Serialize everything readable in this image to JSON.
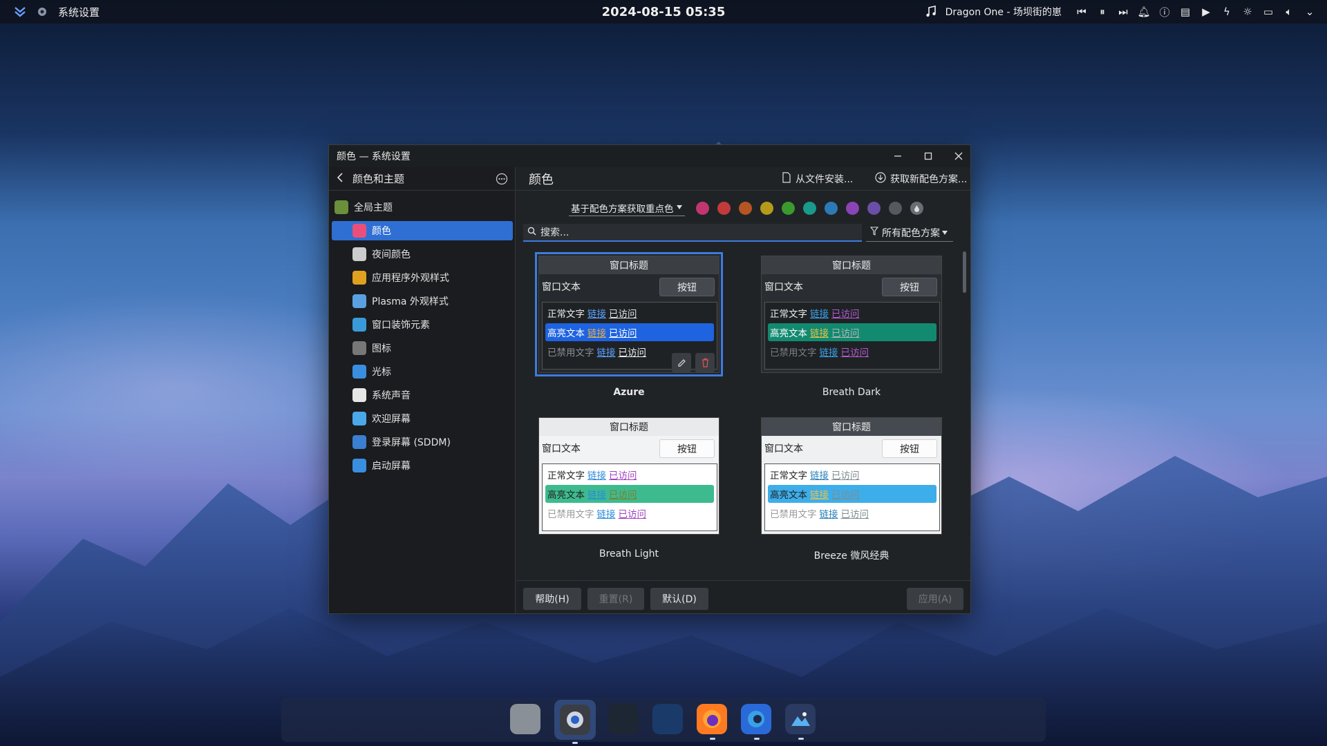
{
  "topbar": {
    "app_name": "系统设置",
    "datetime": "2024-08-15 05:35",
    "media_title": "Dragon One - 场坝街的崽"
  },
  "window": {
    "title": "颜色 — 系统设置",
    "sidebar_header": "颜色和主题",
    "page_title": "颜色",
    "install_from_file": "从文件安装...",
    "get_new": "获取新配色方案..."
  },
  "sidebar": {
    "items": [
      {
        "label": "全局主题",
        "icon": "global-theme-icon",
        "color": "#6b8f3a"
      },
      {
        "label": "颜色",
        "icon": "color-icon",
        "color": "#e8507a",
        "active": true
      },
      {
        "label": "夜间颜色",
        "icon": "bulb-icon",
        "color": "#cccccc"
      },
      {
        "label": "应用程序外观样式",
        "icon": "app-style-icon",
        "color": "#e0a020"
      },
      {
        "label": "Plasma 外观样式",
        "icon": "plasma-style-icon",
        "color": "#5aa0e0"
      },
      {
        "label": "窗口装饰元素",
        "icon": "window-deco-icon",
        "color": "#3a9ad9"
      },
      {
        "label": "图标",
        "icon": "icons-icon",
        "color": "#777777"
      },
      {
        "label": "光标",
        "icon": "cursor-icon",
        "color": "#3a8ee0"
      },
      {
        "label": "系统声音",
        "icon": "music-icon",
        "color": "#e6e6e6"
      },
      {
        "label": "欢迎屏幕",
        "icon": "splash-icon",
        "color": "#4aa8e8"
      },
      {
        "label": "登录屏幕 (SDDM)",
        "icon": "login-icon",
        "color": "#3a7fd0"
      },
      {
        "label": "启动屏幕",
        "icon": "boot-icon",
        "color": "#3a8ee0"
      }
    ]
  },
  "filters": {
    "accent_select": "基于配色方案获取重点色",
    "accent_colors": [
      "#c2366f",
      "#c23b3b",
      "#b55524",
      "#b59a1c",
      "#3a9a2e",
      "#1a9a8a",
      "#2c7ab5",
      "#8a44b5",
      "#6b4ea8",
      "#555a60",
      "#6a6e74"
    ],
    "search_placeholder": "搜索...",
    "scheme_filter": "所有配色方案"
  },
  "schemes": [
    {
      "name": "Azure",
      "title": "窗口标题",
      "window_text": "窗口文本",
      "button": "按钮",
      "normal": "正常文字",
      "link": "链接",
      "visited": "已访问",
      "highlight": "高亮文本",
      "disabled": "已禁用文字",
      "selected": true
    },
    {
      "name": "Breath Dark",
      "title": "窗口标题",
      "window_text": "窗口文本",
      "button": "按钮",
      "normal": "正常文字",
      "link": "链接",
      "visited": "已访问",
      "highlight": "高亮文本",
      "disabled": "已禁用文字"
    },
    {
      "name": "Breath Light",
      "title": "窗口标题",
      "window_text": "窗口文本",
      "button": "按钮",
      "normal": "正常文字",
      "link": "链接",
      "visited": "已访问",
      "highlight": "高亮文本",
      "disabled": "已禁用文字"
    },
    {
      "name": "Breeze 微风经典",
      "title": "窗口标题",
      "window_text": "窗口文本",
      "button": "按钮",
      "normal": "正常文字",
      "link": "链接",
      "visited": "已访问",
      "highlight": "高亮文本",
      "disabled": "已禁用文字"
    }
  ],
  "buttons": {
    "help": "帮助(H)",
    "reset": "重置(R)",
    "defaults": "默认(D)",
    "apply": "应用(A)"
  },
  "dock": [
    "overview-icon",
    "system-settings-icon",
    "app-launcher-icon",
    "file-manager-icon",
    "firefox-icon",
    "edge-icon",
    "photos-icon"
  ]
}
